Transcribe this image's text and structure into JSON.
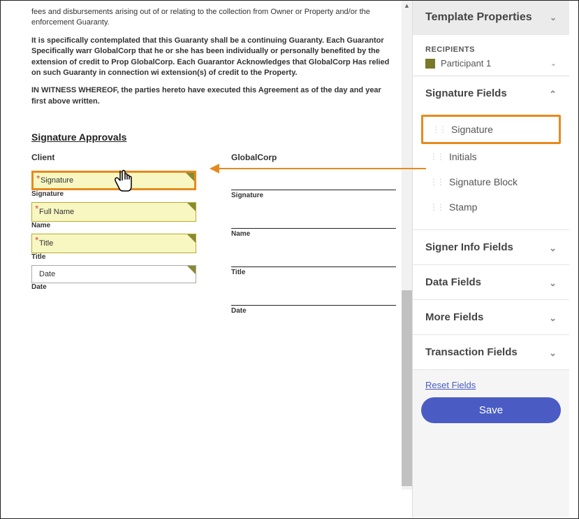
{
  "document": {
    "paragraph1": "fees and disbursements arising out of or relating to the collection from Owner or Property and/or the enforcement Guaranty.",
    "paragraph2": "It is specifically contemplated that this Guaranty shall be a continuing Guaranty. Each Guarantor Specifically warr GlobalCorp that he or she has been individually or personally benefited by the extension of credit to Prop GlobalCorp. Each Guarantor Acknowledges that GlobalCorp Has relied on such Guaranty in connection wi extension(s) of credit to the Property.",
    "paragraph3": "IN WITNESS WHEREOF, the parties hereto have executed this Agreement as of the day and year first above written.",
    "section_title": "Signature Approvals",
    "client_header": "Client",
    "company_header": "GlobalCorp",
    "labels": {
      "signature": "Signature",
      "name": "Name",
      "title": "Title",
      "date": "Date"
    },
    "fields": {
      "signature": "Signature",
      "fullname": "Full Name",
      "title": "Title",
      "date": "Date"
    }
  },
  "sidebar": {
    "title": "Template Properties",
    "recipients_label": "RECIPIENTS",
    "recipient_name": "Participant 1",
    "sections": {
      "signature_fields": "Signature Fields",
      "signer_info": "Signer Info Fields",
      "data_fields": "Data Fields",
      "more_fields": "More Fields",
      "transaction_fields": "Transaction Fields"
    },
    "field_items": {
      "signature": "Signature",
      "initials": "Initials",
      "signature_block": "Signature Block",
      "stamp": "Stamp"
    },
    "reset": "Reset Fields",
    "save": "Save"
  }
}
